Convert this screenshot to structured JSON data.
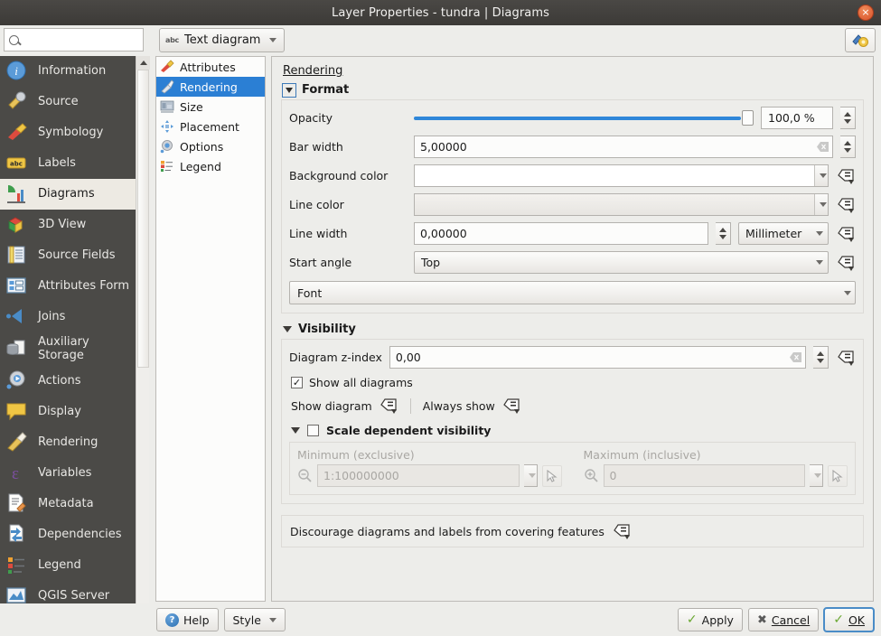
{
  "window": {
    "title": "Layer Properties - tundra | Diagrams",
    "close_label": "×"
  },
  "toolbar": {
    "search_placeholder": "",
    "search_value": "",
    "search_icon": "search-icon",
    "diagram_type": "Text diagram",
    "diagram_type_badge": "abc",
    "style_icon": "style-manager-icon"
  },
  "sidebar": {
    "items": [
      {
        "label": "Information",
        "icon": "information-icon",
        "active": false
      },
      {
        "label": "Source",
        "icon": "source-icon",
        "active": false
      },
      {
        "label": "Symbology",
        "icon": "symbology-icon",
        "active": false
      },
      {
        "label": "Labels",
        "icon": "labels-icon",
        "active": false
      },
      {
        "label": "Diagrams",
        "icon": "diagrams-icon",
        "active": true
      },
      {
        "label": "3D View",
        "icon": "3d-view-icon",
        "active": false
      },
      {
        "label": "Source Fields",
        "icon": "source-fields-icon",
        "active": false
      },
      {
        "label": "Attributes Form",
        "icon": "attributes-form-icon",
        "active": false
      },
      {
        "label": "Joins",
        "icon": "joins-icon",
        "active": false
      },
      {
        "label": "Auxiliary Storage",
        "icon": "auxiliary-storage-icon",
        "active": false
      },
      {
        "label": "Actions",
        "icon": "actions-icon",
        "active": false
      },
      {
        "label": "Display",
        "icon": "display-icon",
        "active": false
      },
      {
        "label": "Rendering",
        "icon": "rendering-icon",
        "active": false
      },
      {
        "label": "Variables",
        "icon": "variables-icon",
        "active": false
      },
      {
        "label": "Metadata",
        "icon": "metadata-icon",
        "active": false
      },
      {
        "label": "Dependencies",
        "icon": "dependencies-icon",
        "active": false
      },
      {
        "label": "Legend",
        "icon": "legend-icon",
        "active": false
      },
      {
        "label": "QGIS Server",
        "icon": "qgis-server-icon",
        "active": false
      }
    ]
  },
  "subtabs": {
    "items": [
      {
        "label": "Attributes",
        "icon": "attributes-icon",
        "active": false
      },
      {
        "label": "Rendering",
        "icon": "rendering-icon",
        "active": true
      },
      {
        "label": "Size",
        "icon": "size-icon",
        "active": false
      },
      {
        "label": "Placement",
        "icon": "placement-icon",
        "active": false
      },
      {
        "label": "Options",
        "icon": "options-icon",
        "active": false
      },
      {
        "label": "Legend",
        "icon": "legend-icon",
        "active": false
      }
    ]
  },
  "main": {
    "page_title": "Rendering",
    "format": {
      "heading": "Format",
      "opacity_label": "Opacity",
      "opacity_value": "100,0 %",
      "opacity_percent": 100,
      "bar_width_label": "Bar width",
      "bar_width_value": "5,00000",
      "background_color_label": "Background color",
      "background_color_value": "#ffffff",
      "line_color_label": "Line color",
      "line_color_value": "transparent",
      "line_width_label": "Line width",
      "line_width_value": "0,00000",
      "line_width_unit": "Millimeter",
      "start_angle_label": "Start angle",
      "start_angle_value": "Top",
      "font_button": "Font"
    },
    "visibility": {
      "heading": "Visibility",
      "z_index_label": "Diagram z-index",
      "z_index_value": "0,00",
      "show_all_label": "Show all diagrams",
      "show_all_checked": true,
      "show_diagram_label": "Show diagram",
      "always_show_label": "Always show",
      "scale_dependent_label": "Scale dependent visibility",
      "scale_dependent_checked": false,
      "minimum_label": "Minimum (exclusive)",
      "minimum_value": "1:100000000",
      "maximum_label": "Maximum (inclusive)",
      "maximum_value": "0"
    },
    "discourage_label": "Discourage diagrams and labels from covering features"
  },
  "buttons": {
    "help": "Help",
    "style": "Style",
    "apply": "Apply",
    "cancel": "Cancel",
    "ok": "OK"
  },
  "colors": {
    "accent_blue": "#2b7fd4",
    "slider_blue": "#2f87d9",
    "titlebar": "#413f3c",
    "sidebar_bg": "#4b4a47",
    "panel_bg": "#ededea",
    "check_green": "#6aa832"
  }
}
